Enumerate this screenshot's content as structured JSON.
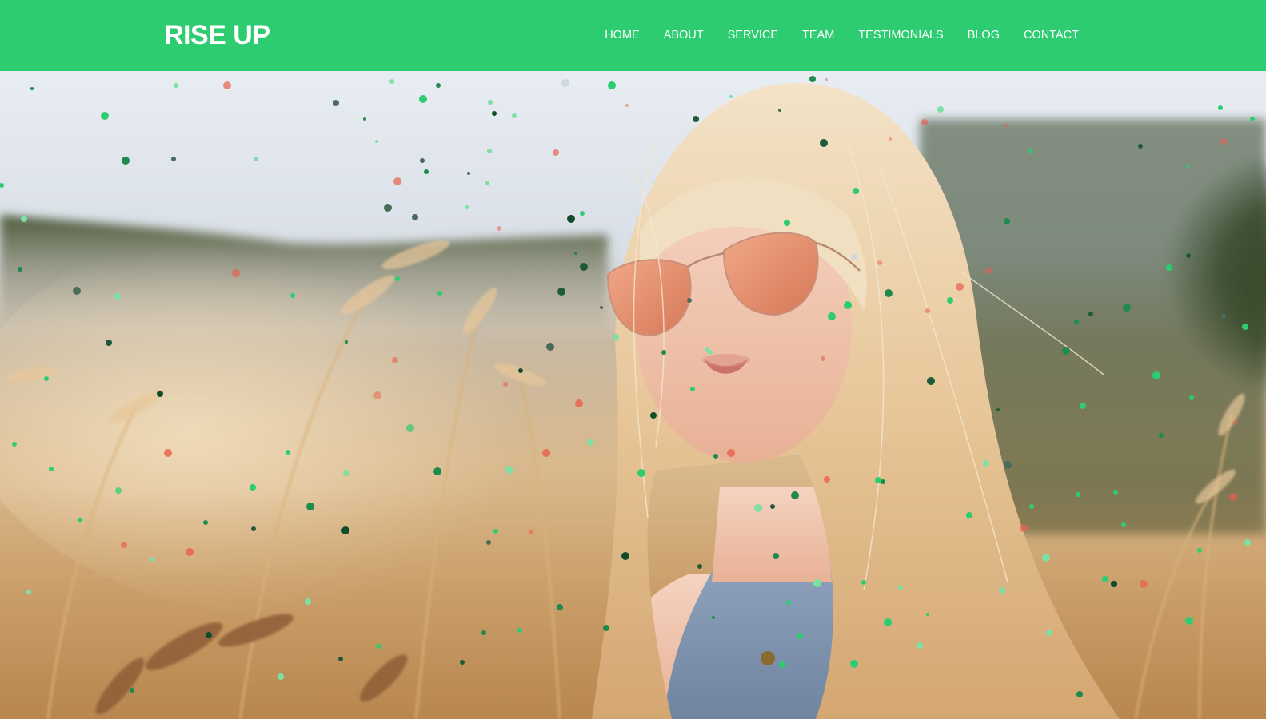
{
  "brand": {
    "name": "RISE UP",
    "color": "#2ecc71"
  },
  "nav": {
    "items": [
      {
        "label": "HOME"
      },
      {
        "label": "ABOUT"
      },
      {
        "label": "SERVICE"
      },
      {
        "label": "TEAM"
      },
      {
        "label": "TESTIMONIALS"
      },
      {
        "label": "BLOG"
      },
      {
        "label": "CONTACT"
      }
    ]
  },
  "hero": {
    "image_subject": "woman-with-sunglasses-in-wheat-field",
    "particle_colors": [
      "#2ecc71",
      "#1e8a4c",
      "#0f4d2a",
      "#e8604c",
      "#7ee0a4"
    ]
  }
}
